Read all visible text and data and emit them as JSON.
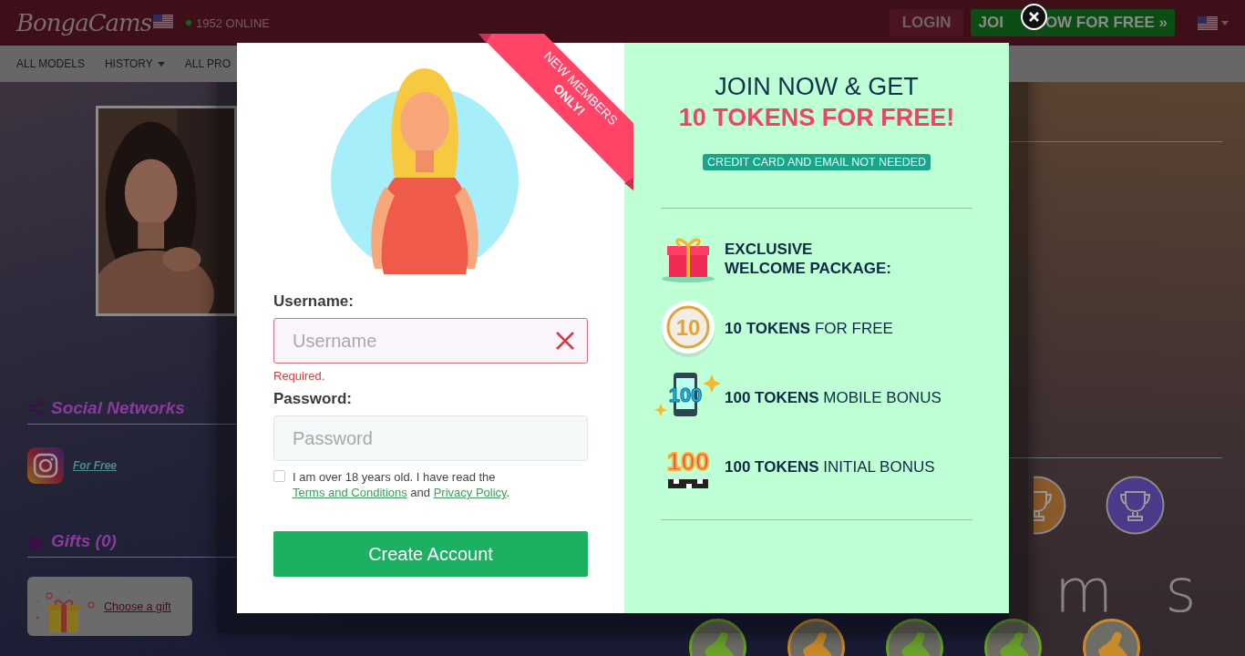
{
  "header": {
    "logo": "BongaCams",
    "online": "1952 ONLINE",
    "login_button": "LOGIN",
    "join_button": [
      "JOI",
      "OW FOR FREE »"
    ]
  },
  "nav": [
    {
      "label": "ALL MODELS",
      "dropdown": false
    },
    {
      "label": "HISTORY",
      "dropdown": true
    },
    {
      "label": "ALL PRO",
      "dropdown": false
    }
  ],
  "sidebar": {
    "social_title": "Social Networks",
    "social_link": "For Free",
    "gifts_title": "Gifts (0)",
    "gift_action": "Choose a gift"
  },
  "wordmark": "m s",
  "signup_modal": {
    "ribbon": [
      "NEW MEMBERS",
      "ONLY!"
    ],
    "username": {
      "label": "Username:",
      "placeholder": "Username",
      "invalid": true,
      "error": "Required."
    },
    "password": {
      "label": "Password:",
      "placeholder": "Password",
      "invalid": false
    },
    "agreement": {
      "checked": false,
      "parts": [
        {
          "kind": "text",
          "text": "I am over 18 years old. I have read the "
        },
        {
          "kind": "link",
          "text": "Terms and Conditions"
        },
        {
          "kind": "text",
          "text": " and "
        },
        {
          "kind": "link",
          "text": "Privacy Policy"
        },
        {
          "kind": "text",
          "text": "."
        }
      ]
    },
    "submit": "Create Account",
    "promo": {
      "headline": "JOIN NOW & GET",
      "highlight": "10 TOKENS FOR FREE!",
      "note": "CREDIT CARD AND EMAIL NOT NEEDED",
      "perks": [
        {
          "kind": "gift",
          "lines": [
            "**EXCLUSIVE**",
            "**WELCOME PACKAGE:**"
          ]
        },
        {
          "kind": "coin",
          "icon_text": "10",
          "lines": [
            "**10 TOKENS** FOR FREE"
          ]
        },
        {
          "kind": "mobile",
          "icon_text": "100",
          "lines": [
            "**100 TOKENS** MOBILE BONUS"
          ]
        },
        {
          "kind": "hundred",
          "icon_text": "100",
          "lines": [
            "**100 TOKENS** INITIAL BONUS"
          ]
        }
      ]
    }
  }
}
